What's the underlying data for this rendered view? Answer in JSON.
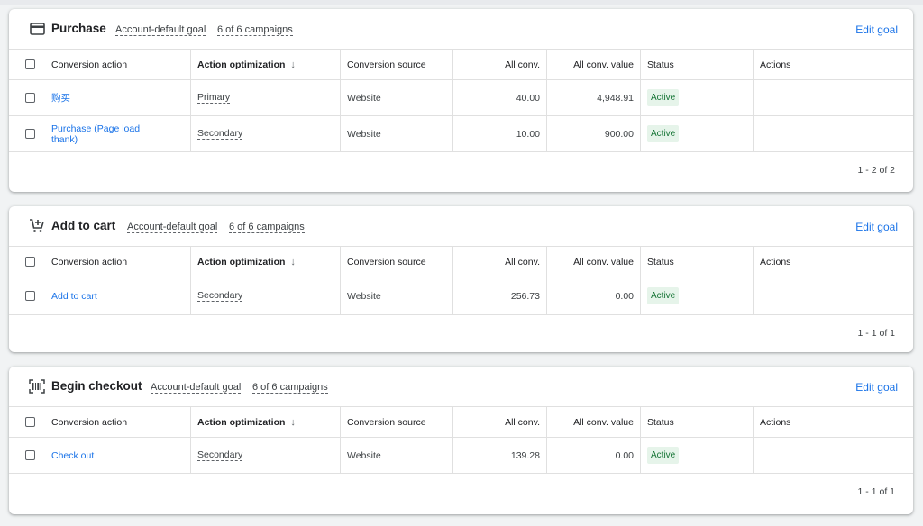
{
  "columns": {
    "action": "Conversion action",
    "optimization": "Action optimization",
    "source": "Conversion source",
    "all_conv": "All conv.",
    "all_conv_value": "All conv. value",
    "status": "Status",
    "actions": "Actions"
  },
  "sort_icon": "arrow-down-icon",
  "goals": [
    {
      "icon": "credit-card-icon",
      "title": "Purchase",
      "default_goal": "Account-default goal",
      "campaigns": "6 of 6 campaigns",
      "edit": "Edit goal",
      "rows": [
        {
          "name": "购买",
          "optimization": "Primary",
          "source": "Website",
          "all_conv": "40.00",
          "value": "4,948.91",
          "status": "Active"
        },
        {
          "name": "Purchase (Page load thank)",
          "optimization": "Secondary",
          "source": "Website",
          "all_conv": "10.00",
          "value": "900.00",
          "status": "Active"
        }
      ],
      "pager": "1 - 2 of 2"
    },
    {
      "icon": "add-to-cart-icon",
      "title": "Add to cart",
      "default_goal": "Account-default goal",
      "campaigns": "6 of 6 campaigns",
      "edit": "Edit goal",
      "rows": [
        {
          "name": "Add to cart",
          "optimization": "Secondary",
          "source": "Website",
          "all_conv": "256.73",
          "value": "0.00",
          "status": "Active"
        }
      ],
      "pager": "1 - 1 of 1"
    },
    {
      "icon": "barcode-scanner-icon",
      "title": "Begin checkout",
      "default_goal": "Account-default goal",
      "campaigns": "6 of 6 campaigns",
      "edit": "Edit goal",
      "rows": [
        {
          "name": "Check out",
          "optimization": "Secondary",
          "source": "Website",
          "all_conv": "139.28",
          "value": "0.00",
          "status": "Active"
        }
      ],
      "pager": "1 - 1 of 1"
    }
  ]
}
